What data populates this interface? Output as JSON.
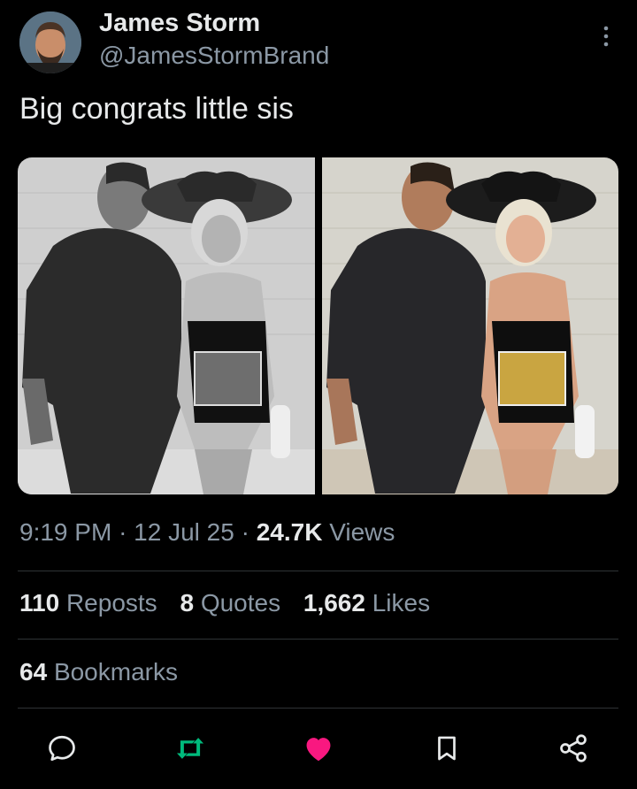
{
  "author": {
    "name": "James Storm",
    "handle": "@JamesStormBrand"
  },
  "tweet": {
    "text": "Big congrats little sis"
  },
  "meta": {
    "time": "9:19 PM",
    "date": "12 Jul 25",
    "views_count": "24.7K",
    "views_label": "Views",
    "separator": "·"
  },
  "stats": {
    "reposts_count": "110",
    "reposts_label": "Reposts",
    "quotes_count": "8",
    "quotes_label": "Quotes",
    "likes_count": "1,662",
    "likes_label": "Likes",
    "bookmarks_count": "64",
    "bookmarks_label": "Bookmarks"
  },
  "actions": {
    "reply_icon": "reply-icon",
    "repost_icon": "repost-icon",
    "like_icon": "heart-icon",
    "bookmark_icon": "bookmark-icon",
    "share_icon": "share-icon"
  },
  "colors": {
    "background": "#000000",
    "text": "#e7e9ea",
    "muted": "#8b98a5",
    "repost_active": "#00ba7c",
    "like_active": "#f91880"
  }
}
